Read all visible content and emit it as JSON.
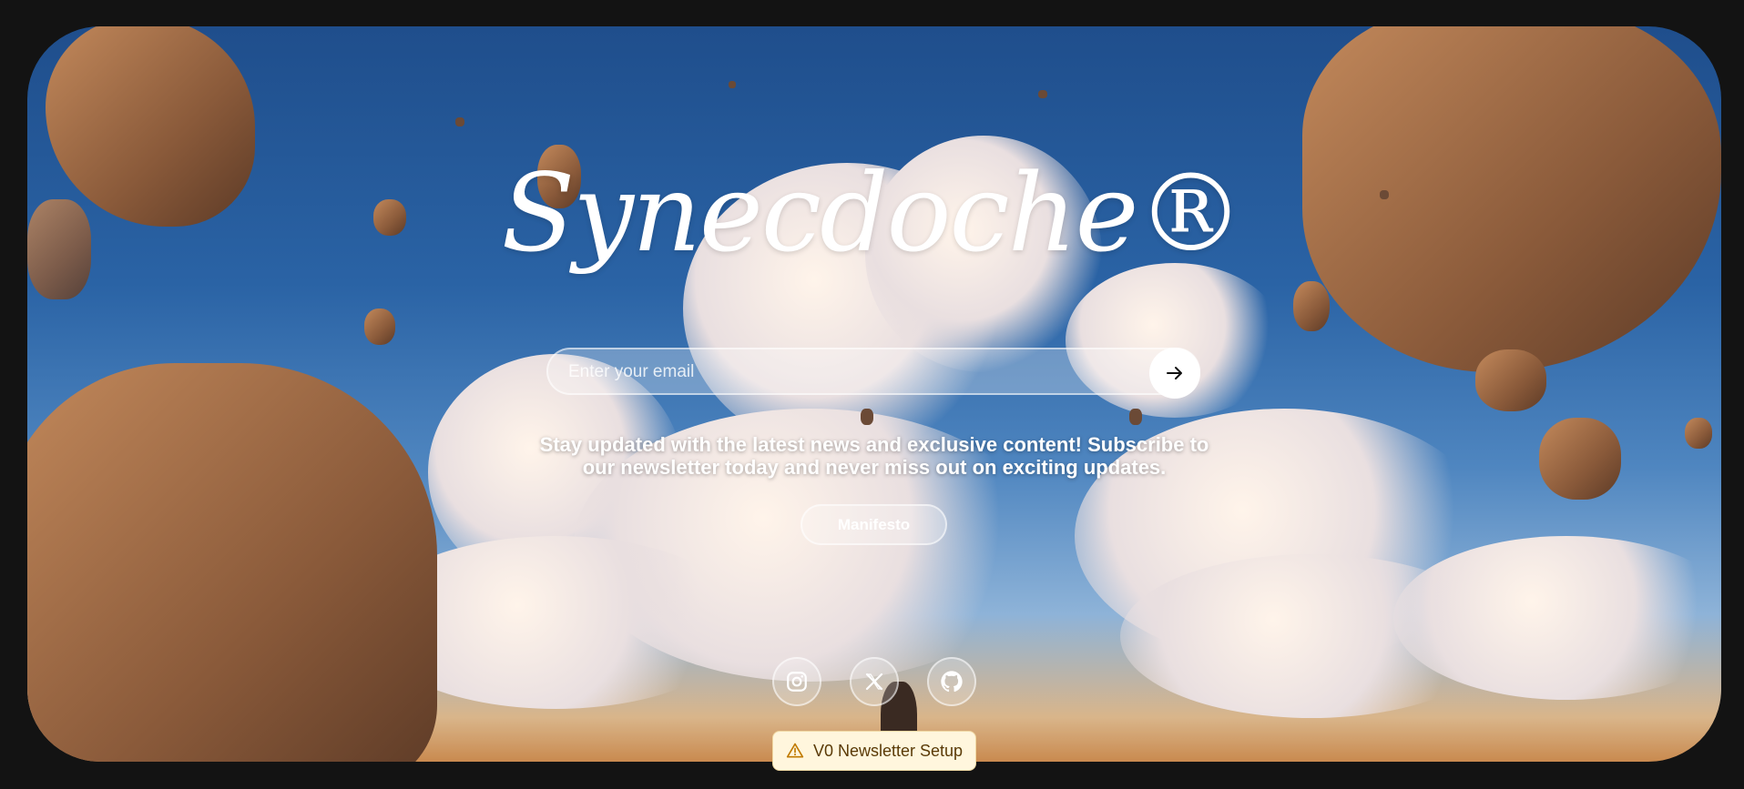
{
  "hero": {
    "title": "Synecdoche®",
    "email_placeholder": "Enter your email",
    "description_line1": "Stay updated with the latest news and exclusive content! Subscribe to",
    "description_line2": "our newsletter today and never miss out on exciting updates.",
    "manifesto_label": "Manifesto"
  },
  "social": {
    "icons": [
      "instagram-icon",
      "x-icon",
      "github-icon"
    ]
  },
  "toast": {
    "label": "V0 Newsletter Setup",
    "icon": "warning-icon"
  },
  "colors": {
    "page_bg": "#131313",
    "sky": "#2a63a5",
    "toast_bg": "#fff6dd",
    "toast_text": "#5a3a06"
  }
}
